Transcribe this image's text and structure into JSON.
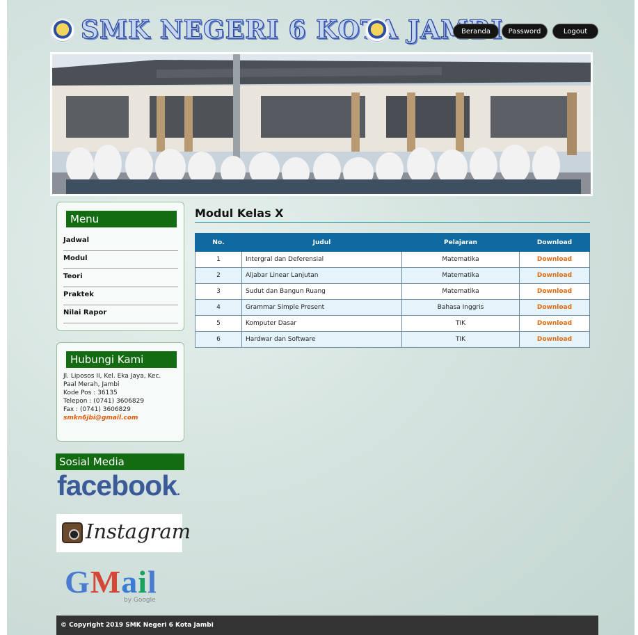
{
  "header": {
    "site_title": "SMK NEGERI 6 KOTA JAMBI",
    "nav": {
      "beranda": "Beranda",
      "password": "Password",
      "logout": "Logout"
    }
  },
  "sidebar": {
    "menu_title": "Menu",
    "menu_items": [
      "Jadwal",
      "Modul",
      "Teori",
      "Praktek",
      "Nilai Rapor"
    ],
    "contact_title": "Hubungi Kami",
    "contact_lines": [
      "Jl. Liposos II, Kel. Eka Jaya, Kec.",
      "Paal Merah, Jambi",
      "Kode Pos : 36135",
      "Telepon : (0741) 3606829",
      "Fax : (0741) 3606829"
    ],
    "contact_email": "smkn6jbi@gmail.com",
    "social_title": "Sosial Media",
    "facebook": "facebook",
    "instagram": "Instagram",
    "gmail": "Gmail",
    "gmail_by": "by Google"
  },
  "main": {
    "title": "Modul Kelas X",
    "columns": [
      "No.",
      "Judul",
      "Pelajaran",
      "Download"
    ],
    "rows": [
      {
        "no": "1",
        "judul": "Intergral dan Deferensial",
        "pelajaran": "Matematika",
        "download": "Download"
      },
      {
        "no": "2",
        "judul": "Aljabar Linear Lanjutan",
        "pelajaran": "Matematika",
        "download": "Download"
      },
      {
        "no": "3",
        "judul": "Sudut dan Bangun Ruang",
        "pelajaran": "Matematika",
        "download": "Download"
      },
      {
        "no": "4",
        "judul": "Grammar Simple Present",
        "pelajaran": "Bahasa Inggris",
        "download": "Download"
      },
      {
        "no": "5",
        "judul": "Komputer Dasar",
        "pelajaran": "TIK",
        "download": "Download"
      },
      {
        "no": "6",
        "judul": "Hardwar dan Software",
        "pelajaran": "TIK",
        "download": "Download"
      }
    ]
  },
  "footer": {
    "copyright": "© Copyright 2019 SMK Negeri 6 Kota Jambi"
  },
  "colors": {
    "accent_green": "#136c12",
    "table_header": "#0e6aa0",
    "download_link": "#e06a10"
  }
}
